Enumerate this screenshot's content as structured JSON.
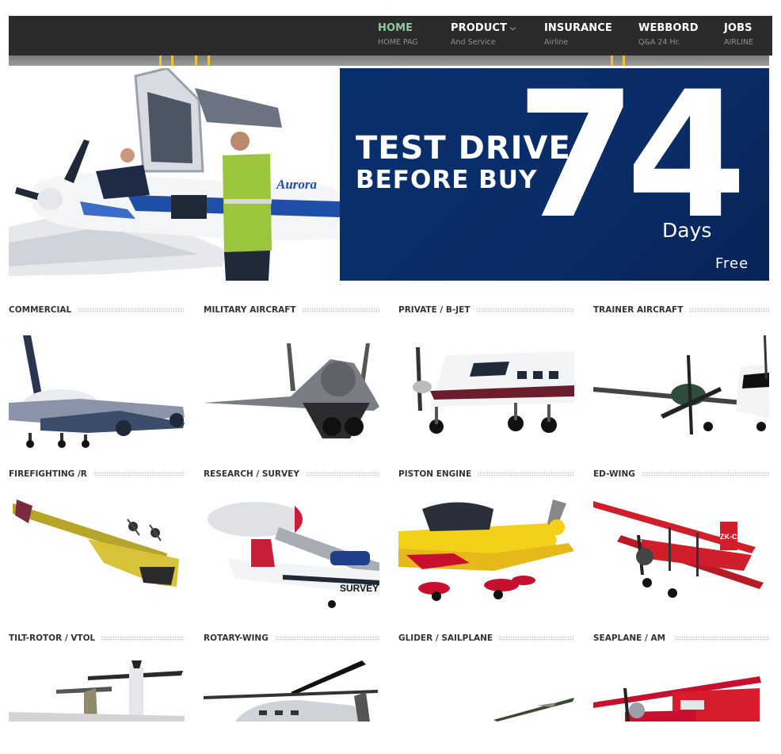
{
  "nav": {
    "items": [
      {
        "title": "HOME",
        "sub": "HOME PAG",
        "active": true
      },
      {
        "title": "PRODUCT",
        "sub": "And Service",
        "dropdown": true
      },
      {
        "title": "INSURANCE",
        "sub": "Airline"
      },
      {
        "title": "WEBBORD",
        "sub": "Q&A 24 Hr."
      },
      {
        "title": "JOBS",
        "sub": "AIRLINE"
      }
    ],
    "caret_icon": "chevron-down-icon"
  },
  "hero": {
    "line1": "TEST DRIVE",
    "line2": "BEFORE BUY",
    "big_number": "74",
    "unit": "Days",
    "free": "Free",
    "aircraft_brand": "Aurora",
    "bg_color": "#0a2c67"
  },
  "categories": [
    {
      "label": "COMMERCIAL",
      "icon": "airliner-icon"
    },
    {
      "label": "MILITARY AIRCRAFT",
      "icon": "fighter-jet-icon"
    },
    {
      "label": "PRIVATE / B-JET",
      "icon": "private-plane-icon"
    },
    {
      "label": "TRAINER AIRCRAFT",
      "icon": "trainer-plane-icon"
    },
    {
      "label": "FIREFIGHTING /R",
      "icon": "firefighting-plane-icon"
    },
    {
      "label": "RESEARCH / SURVEY",
      "icon": "survey-plane-icon"
    },
    {
      "label": "PISTON ENGINE",
      "icon": "piston-plane-icon"
    },
    {
      "label": "ED-WING",
      "icon": "biplane-icon",
      "registration": "ZK-CAT"
    },
    {
      "label": "TILT-ROTOR / VTOL",
      "icon": "tiltrotor-icon"
    },
    {
      "label": "ROTARY-WING",
      "icon": "helicopter-icon"
    },
    {
      "label": "GLIDER / SAILPLANE",
      "icon": "glider-icon"
    },
    {
      "label": "SEAPLANE / AM",
      "icon": "seaplane-icon"
    }
  ],
  "survey_plane_text": "SURVEY",
  "colors": {
    "nav_bg": "#2b2b2b",
    "nav_active": "#8fc9a4",
    "hero_blue": "#0a2c67"
  }
}
